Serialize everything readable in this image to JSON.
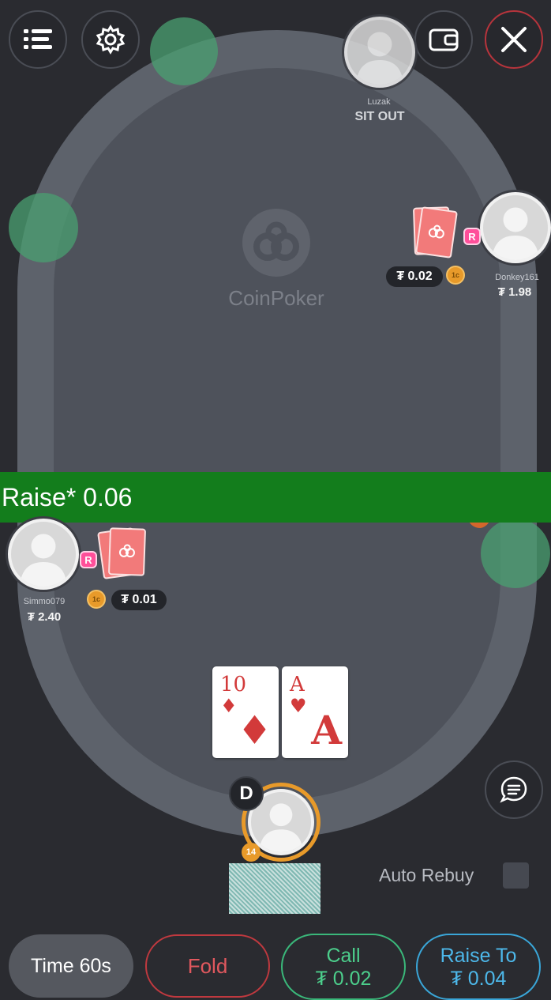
{
  "top_bar": {
    "menu_icon": "menu-list-icon",
    "settings_icon": "gear-icon",
    "wallet_icon": "wallet-icon",
    "close_icon": "close-icon"
  },
  "logo": {
    "text": "CoinPoker"
  },
  "players": {
    "top": {
      "name": "Luzak",
      "status": "SIT OUT"
    },
    "right": {
      "name": "Donkey161",
      "stack": "₮ 1.98",
      "bet": "₮ 0.02",
      "badge": "R"
    },
    "left": {
      "name": "Simmo079",
      "stack": "₮ 2.40",
      "bet": "₮ 0.01",
      "badge": "R"
    },
    "hero": {
      "dealer": "D",
      "level": "14"
    }
  },
  "banner": {
    "text": "Raise* 0.06"
  },
  "hero_cards": [
    {
      "rank": "10",
      "suit": "♦"
    },
    {
      "rank": "A",
      "suit": "♥"
    }
  ],
  "chip_label": "1c",
  "auto_rebuy": {
    "label": "Auto Rebuy",
    "checked": false
  },
  "actions": {
    "time": "Time 60s",
    "fold": "Fold",
    "call_label": "Call",
    "call_amount": "₮ 0.02",
    "raise_label": "Raise To",
    "raise_amount": "₮ 0.04"
  },
  "colors": {
    "banner": "#137d1c",
    "fold": "#c0393f",
    "call": "#3ab87a",
    "raise": "#3aa6d8",
    "card_red": "#d23a3a"
  }
}
